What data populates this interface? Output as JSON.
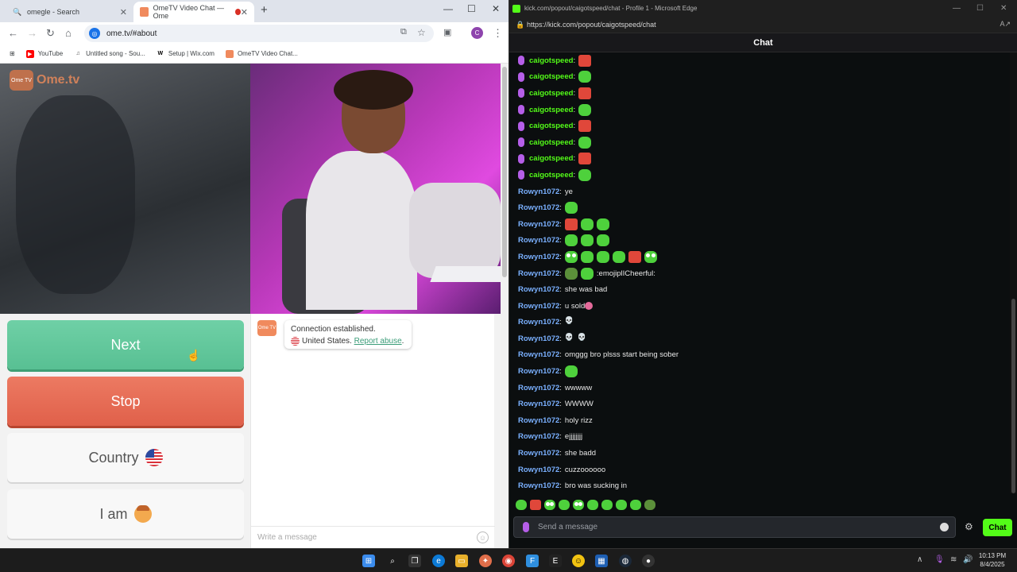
{
  "chrome": {
    "tabs": [
      {
        "label": "omegle - Search",
        "icon": "search-icon"
      },
      {
        "label": "OmeTV Video Chat — Ome",
        "icon": "ometv-favicon"
      }
    ],
    "url": "ome.tv/#about",
    "profile_initial": "C",
    "bookmarks": [
      {
        "label": "YouTube",
        "icon": "youtube-icon"
      },
      {
        "label": "Untitled song - Sou...",
        "icon": "soundcloud-icon"
      },
      {
        "label": "Setup | Wix.com",
        "icon": "wix-icon"
      },
      {
        "label": "OmeTV Video Chat...",
        "icon": "ometv-favicon"
      }
    ]
  },
  "ometv": {
    "logo_text": "Ome.tv",
    "logo_badge": "Ome TV",
    "buttons": {
      "next": "Next",
      "stop": "Stop",
      "country": "Country",
      "iam": "I am"
    },
    "status": {
      "line1": "Connection established.",
      "country": "United States.",
      "report": "Report abuse",
      "period": "."
    },
    "message_placeholder": "Write a message",
    "colors": {
      "next": "#58c093",
      "stop": "#e0604a"
    }
  },
  "edge": {
    "title": "kick.com/popout/caigotspeed/chat - Profile 1 - Microsoft Edge",
    "url": "https://kick.com/popout/caigotspeed/chat",
    "chat_header": "Chat",
    "send_placeholder": "Send a message",
    "send_button": "Chat",
    "accent": "#53fc18"
  },
  "chat": [
    {
      "user": "caigotspeed",
      "mod": true,
      "text": "",
      "emotes": [
        "red"
      ]
    },
    {
      "user": "caigotspeed",
      "mod": true,
      "text": "",
      "emotes": [
        "green"
      ]
    },
    {
      "user": "caigotspeed",
      "mod": true,
      "text": "",
      "emotes": [
        "red"
      ]
    },
    {
      "user": "caigotspeed",
      "mod": true,
      "text": "",
      "emotes": [
        "green"
      ]
    },
    {
      "user": "caigotspeed",
      "mod": true,
      "text": "",
      "emotes": [
        "red"
      ]
    },
    {
      "user": "caigotspeed",
      "mod": true,
      "text": "",
      "emotes": [
        "green"
      ]
    },
    {
      "user": "caigotspeed",
      "mod": true,
      "text": "",
      "emotes": [
        "red"
      ]
    },
    {
      "user": "caigotspeed",
      "mod": true,
      "text": "",
      "emotes": [
        "green"
      ]
    },
    {
      "user": "Rowyn1072",
      "mod": false,
      "text": "ye",
      "emotes": []
    },
    {
      "user": "Rowyn1072",
      "mod": false,
      "text": "",
      "emotes": [
        "green"
      ]
    },
    {
      "user": "Rowyn1072",
      "mod": false,
      "text": "",
      "emotes": [
        "red",
        "green",
        "green"
      ]
    },
    {
      "user": "Rowyn1072",
      "mod": false,
      "text": "",
      "emotes": [
        "green",
        "green",
        "green"
      ]
    },
    {
      "user": "Rowyn1072",
      "mod": false,
      "text": "",
      "emotes": [
        "eyes",
        "green",
        "green",
        "green",
        "red",
        "eyes"
      ]
    },
    {
      "user": "Rowyn1072",
      "mod": false,
      "text": ":emojiplICheerful:",
      "emotes": [
        "frog",
        "green"
      ]
    },
    {
      "user": "Rowyn1072",
      "mod": false,
      "text": "she was bad",
      "emotes": []
    },
    {
      "user": "Rowyn1072",
      "mod": false,
      "text": "u sold",
      "emotes": [],
      "trail": [
        "pink"
      ]
    },
    {
      "user": "Rowyn1072",
      "mod": false,
      "text": "",
      "emotes": [
        "skull"
      ]
    },
    {
      "user": "Rowyn1072",
      "mod": false,
      "text": "",
      "emotes": [
        "skull",
        "skull"
      ]
    },
    {
      "user": "Rowyn1072",
      "mod": false,
      "text": "omggg bro plsss start being sober",
      "emotes": []
    },
    {
      "user": "Rowyn1072",
      "mod": false,
      "text": "",
      "emotes": [
        "green"
      ]
    },
    {
      "user": "Rowyn1072",
      "mod": false,
      "text": "wwwww",
      "emotes": []
    },
    {
      "user": "Rowyn1072",
      "mod": false,
      "text": "WWWW",
      "emotes": []
    },
    {
      "user": "Rowyn1072",
      "mod": false,
      "text": "holy rizz",
      "emotes": []
    },
    {
      "user": "Rowyn1072",
      "mod": false,
      "text": "ejjjjjjjj",
      "emotes": []
    },
    {
      "user": "Rowyn1072",
      "mod": false,
      "text": "she badd",
      "emotes": []
    },
    {
      "user": "Rowyn1072",
      "mod": false,
      "text": "cuzzoooooo",
      "emotes": []
    },
    {
      "user": "Rowyn1072",
      "mod": false,
      "text": "bro was sucking in",
      "emotes": []
    }
  ],
  "emote_bar": [
    "green",
    "red",
    "eyes",
    "green",
    "eyes",
    "green",
    "green",
    "green",
    "green",
    "frog"
  ],
  "taskbar": {
    "time": "10:13 PM",
    "date": "8/4/2025"
  }
}
